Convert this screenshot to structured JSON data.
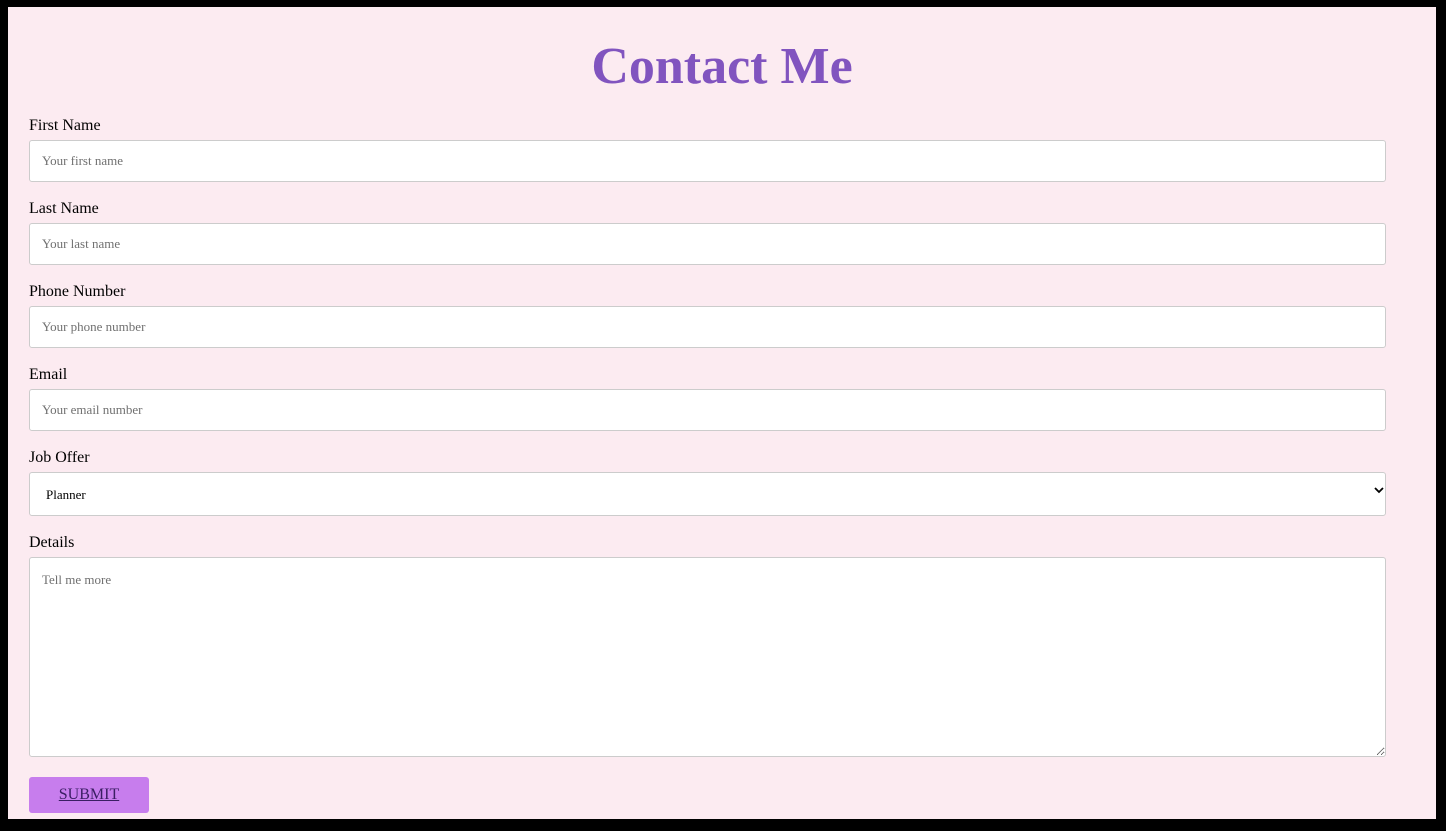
{
  "page": {
    "title": "Contact Me"
  },
  "form": {
    "first_name": {
      "label": "First Name",
      "placeholder": "Your first name"
    },
    "last_name": {
      "label": "Last Name",
      "placeholder": "Your last name"
    },
    "phone": {
      "label": "Phone Number",
      "placeholder": "Your phone number"
    },
    "email": {
      "label": "Email",
      "placeholder": "Your email number"
    },
    "job_offer": {
      "label": "Job Offer",
      "selected": "Planner"
    },
    "details": {
      "label": "Details",
      "placeholder": "Tell me more"
    },
    "submit_label": "SUBMIT"
  },
  "colors": {
    "background": "#fcebf1",
    "title": "#8154bf",
    "button": "#c77ded"
  },
  "icons": {
    "select_arrow": "chevron-down-icon"
  }
}
